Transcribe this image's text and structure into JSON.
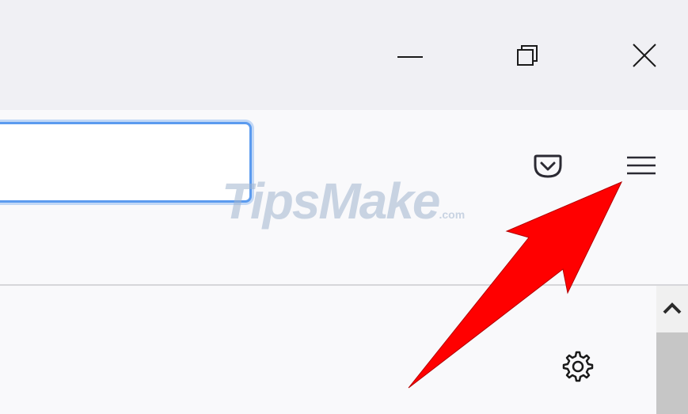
{
  "window_controls": {
    "minimize_icon": "minimize-icon",
    "restore_icon": "restore-icon",
    "close_icon": "close-icon"
  },
  "toolbar": {
    "address_bar_value": "",
    "pocket_icon": "pocket-icon",
    "menu_icon": "hamburger-menu-icon",
    "accent_color": "#5b9bef"
  },
  "watermark": {
    "brand": "TipsMake",
    "suffix": ".com"
  },
  "content": {
    "settings_icon": "gear-icon"
  },
  "annotation": {
    "arrow_color": "#ff0000"
  }
}
